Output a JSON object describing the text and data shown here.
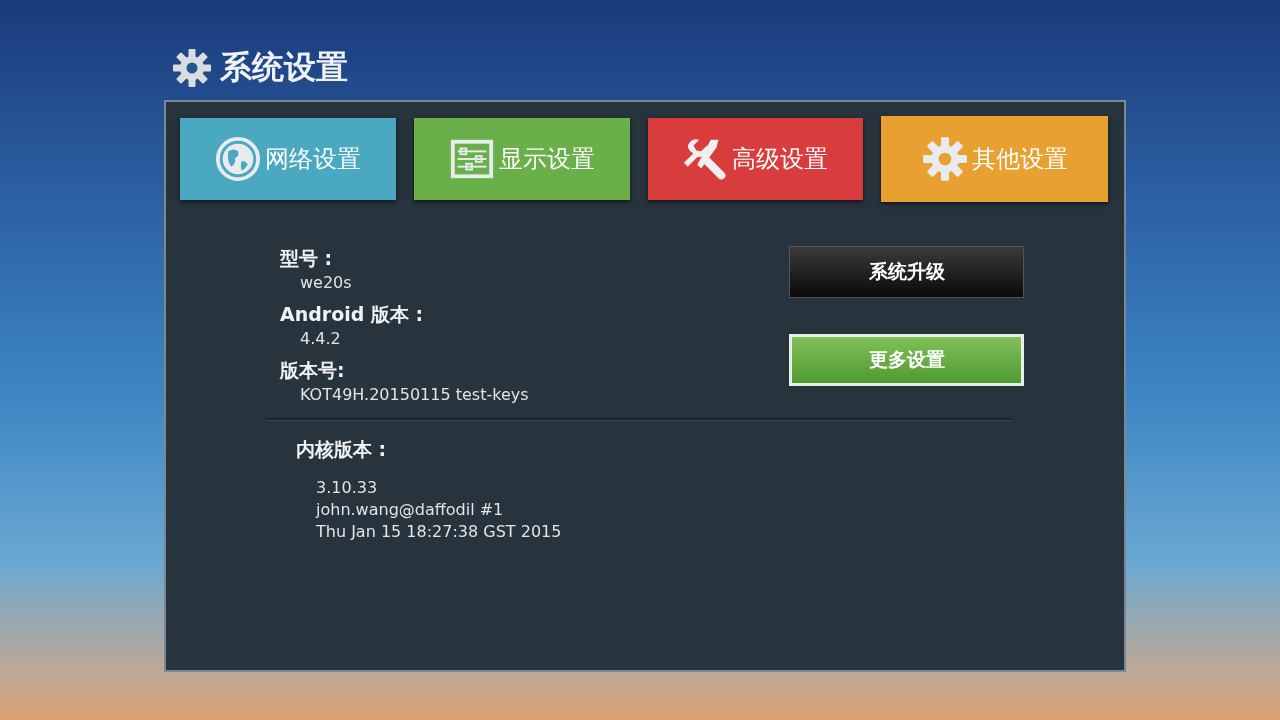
{
  "header": {
    "title": "系统设置"
  },
  "tiles": [
    {
      "label": "网络设置",
      "kind": "globe",
      "color": "#4aa8c0"
    },
    {
      "label": "显示设置",
      "kind": "sliders",
      "color": "#6ab04a"
    },
    {
      "label": "高级设置",
      "kind": "tools",
      "color": "#d83c3c"
    },
    {
      "label": "其他设置",
      "kind": "gear",
      "color": "#e8a030"
    }
  ],
  "info": [
    {
      "label": "型号 :",
      "values": [
        "we20s"
      ]
    },
    {
      "label": "Android 版本 :",
      "values": [
        "4.4.2"
      ]
    },
    {
      "label": "版本号:",
      "values": [
        "KOT49H.20150115 test-keys"
      ]
    }
  ],
  "kernel": {
    "label": "内核版本 :",
    "values": [
      "3.10.33",
      "john.wang@daffodil #1",
      "Thu Jan 15 18:27:38 GST 2015"
    ]
  },
  "buttons": [
    {
      "label": "系统升级",
      "selected": false
    },
    {
      "label": "更多设置",
      "selected": true
    }
  ]
}
